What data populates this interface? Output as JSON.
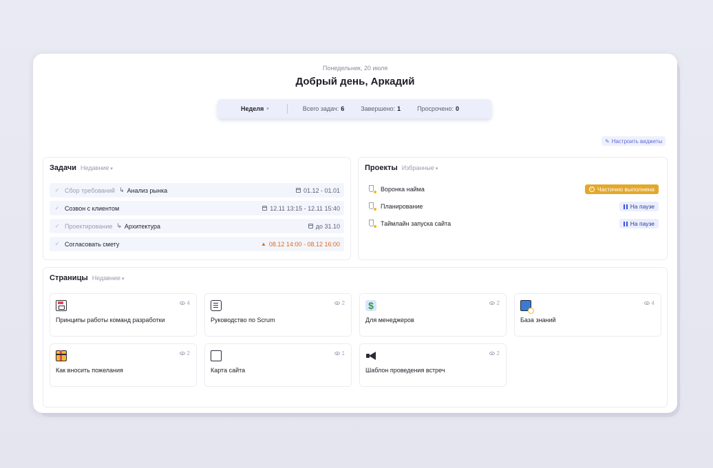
{
  "header": {
    "date": "Понедельник, 20 июля",
    "greeting": "Добрый день, Аркадий"
  },
  "stats": {
    "period": "Неделя",
    "total_label": "Всего задач:",
    "total_value": "6",
    "done_label": "Завершено:",
    "done_value": "1",
    "overdue_label": "Просрочено:",
    "overdue_value": "0"
  },
  "customize_label": "Настроить виджеты",
  "tasks": {
    "title": "Задачи",
    "filter": "Недавние",
    "items": [
      {
        "parent": "Сбор требований",
        "name": "Анализ рынка",
        "dates": "01.12 - 01.01",
        "overdue": false
      },
      {
        "parent": "",
        "name": "Созвон с клиентом",
        "dates": "12.11 13:15 - 12.11 15:40",
        "overdue": false
      },
      {
        "parent": "Проектирование",
        "name": "Архитектура",
        "dates": "до 31.10",
        "overdue": false
      },
      {
        "parent": "",
        "name": "Согласовать смету",
        "dates": "08.12 14:00 - 08.12 16:00",
        "overdue": true
      }
    ]
  },
  "projects": {
    "title": "Проекты",
    "filter": "Избранные",
    "items": [
      {
        "name": "Воронка найма",
        "status": "Частично выполнена",
        "status_type": "partial",
        "color": "#e3a82b"
      },
      {
        "name": "Планирование",
        "status": "На паузе",
        "status_type": "pause",
        "color": "#eaeefc"
      },
      {
        "name": "Таймлайн запуска сайта",
        "status": "На паузе",
        "status_type": "pause",
        "color": "#eaeefc"
      }
    ]
  },
  "pages": {
    "title": "Страницы",
    "filter": "Недавние",
    "items": [
      {
        "title": "Принципы работы команд разработки",
        "views": "4",
        "icon": "floppy-disk-icon"
      },
      {
        "title": "Руководство по Scrum",
        "views": "2",
        "icon": "scroll-icon"
      },
      {
        "title": "Для менеджеров",
        "views": "2",
        "icon": "dollar-icon"
      },
      {
        "title": "База знаний",
        "views": "4",
        "icon": "book-icon"
      },
      {
        "title": "Как вносить пожелания",
        "views": "2",
        "icon": "gift-icon"
      },
      {
        "title": "Карта сайта",
        "views": "1",
        "icon": "frame-icon"
      },
      {
        "title": "Шаблон проведения встреч",
        "views": "2",
        "icon": "megaphone-icon"
      }
    ]
  }
}
